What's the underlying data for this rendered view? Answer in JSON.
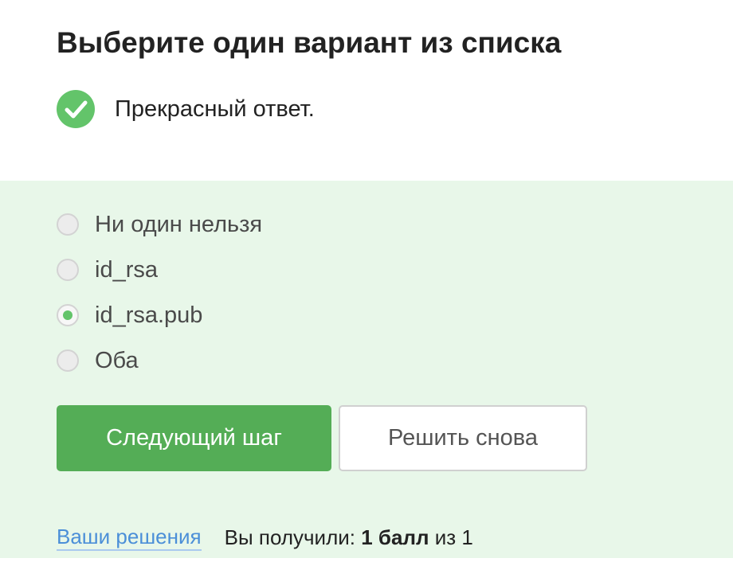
{
  "question": {
    "title": "Выберите один вариант из списка"
  },
  "feedback": {
    "icon": "check-circle-icon",
    "icon_color": "#63c46a",
    "text": "Прекрасный ответ."
  },
  "options": [
    {
      "label": "Ни один нельзя",
      "selected": false
    },
    {
      "label": "id_rsa",
      "selected": false
    },
    {
      "label": "id_rsa.pub",
      "selected": true
    },
    {
      "label": "Оба",
      "selected": false
    }
  ],
  "buttons": {
    "next_label": "Следующий шаг",
    "retry_label": "Решить снова"
  },
  "footer": {
    "solutions_link": "Ваши решения",
    "score_prefix": "Вы получили:",
    "score_value": "1 балл",
    "score_suffix": "из 1"
  },
  "colors": {
    "answer_background": "#e8f7e9",
    "primary_button": "#54ad56",
    "link": "#4b8fd8",
    "radio_selected": "#63c46a"
  }
}
